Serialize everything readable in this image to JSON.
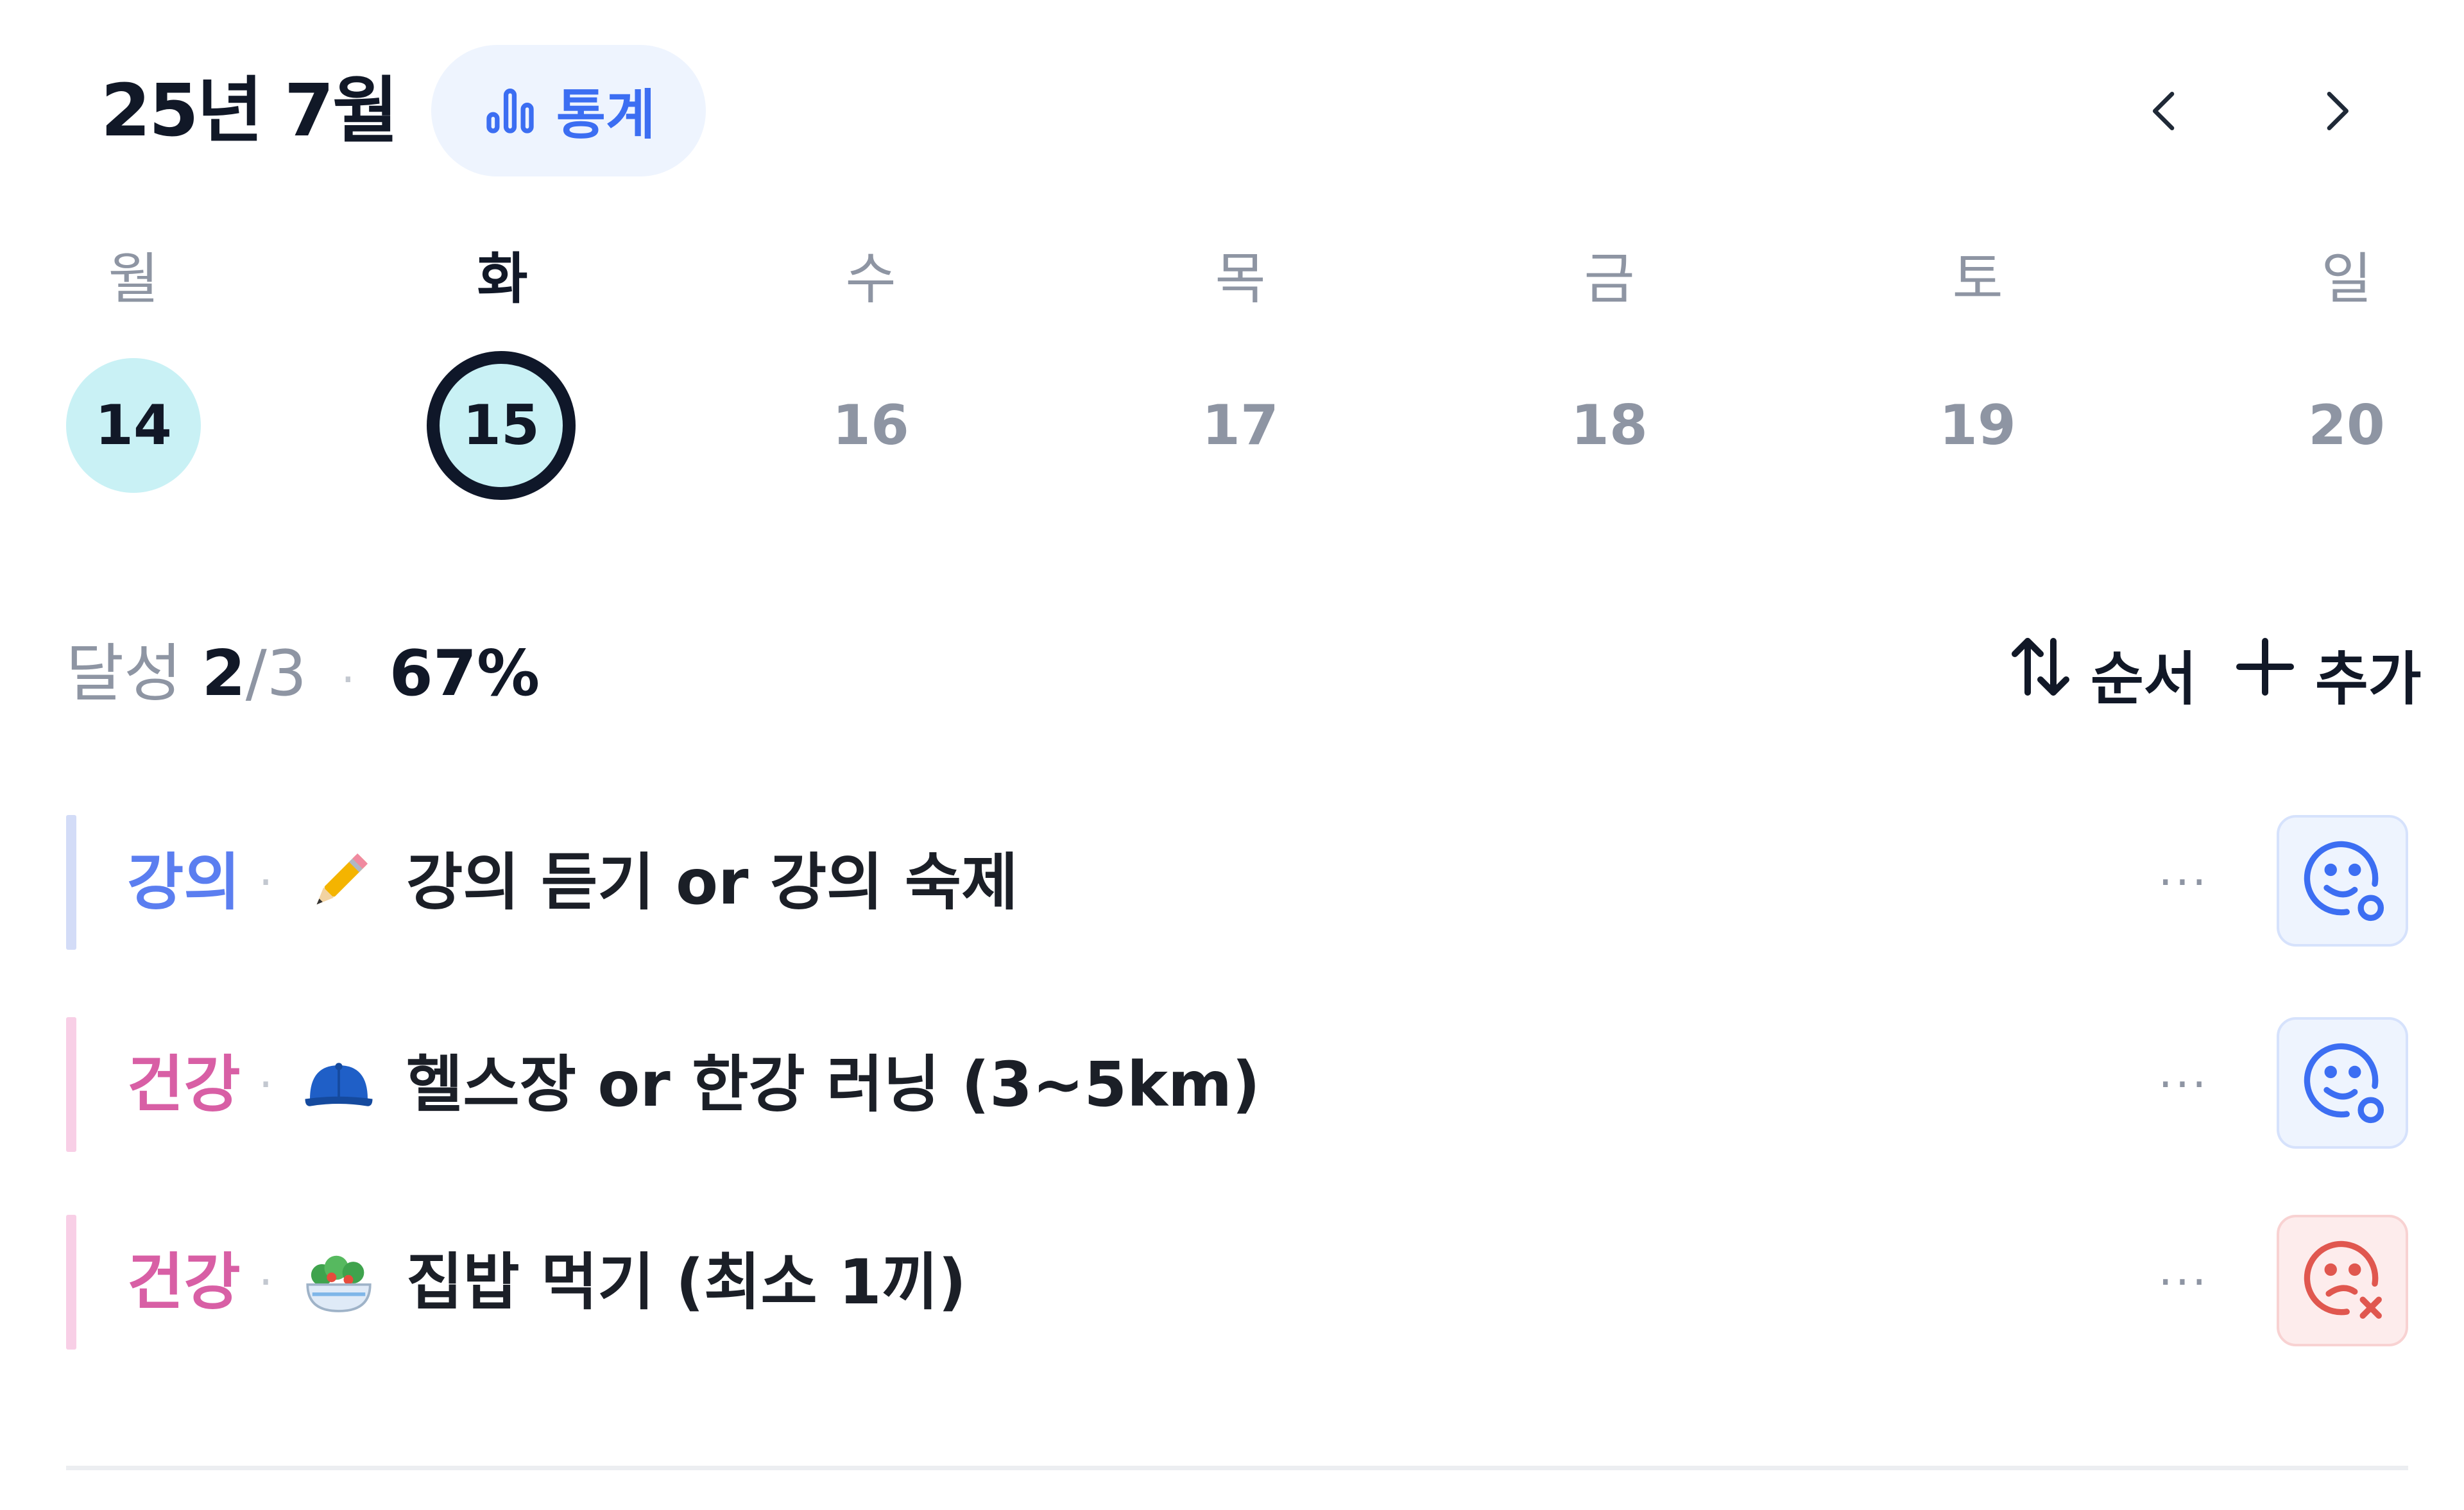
{
  "header": {
    "month_title": "25년 7월",
    "stats_label": "통계",
    "stats_icon": "bar-chart-icon",
    "prev_icon": "chevron-left-icon",
    "next_icon": "chevron-right-icon",
    "accent_color": "#3c6ef2"
  },
  "week": {
    "days": [
      {
        "name": "월",
        "date": "14",
        "state": "done"
      },
      {
        "name": "화",
        "date": "15",
        "state": "selected"
      },
      {
        "name": "수",
        "date": "16",
        "state": "future"
      },
      {
        "name": "목",
        "date": "17",
        "state": "future"
      },
      {
        "name": "금",
        "date": "18",
        "state": "future"
      },
      {
        "name": "토",
        "date": "19",
        "state": "future"
      },
      {
        "name": "일",
        "date": "20",
        "state": "future"
      }
    ],
    "done_color": "#c9f1f5"
  },
  "summary": {
    "label": "달성",
    "done": "2",
    "slash": "/",
    "total": "3",
    "separator": "·",
    "percent": "67%"
  },
  "toolbar": {
    "order_label": "순서",
    "order_icon": "sort-arrows-icon",
    "add_label": "추가",
    "add_icon": "plus-icon"
  },
  "habits": [
    {
      "category": "강의",
      "category_color": "#5b7ef0",
      "bar_color": "#d3dcf7",
      "separator": "·",
      "emoji_icon": "pencil-icon",
      "title": "강의 듣기 or 강의 숙제",
      "more": "···",
      "status": "done",
      "status_icon": "smile-check-icon"
    },
    {
      "category": "건강",
      "category_color": "#d85fa5",
      "bar_color": "#f8cfe6",
      "separator": "·",
      "emoji_icon": "cap-icon",
      "title": "헬스장 or 한강 러닝 (3~5km)",
      "more": "···",
      "status": "done",
      "status_icon": "smile-check-icon"
    },
    {
      "category": "건강",
      "category_color": "#d85fa5",
      "bar_color": "#f8cfe6",
      "separator": "·",
      "emoji_icon": "salad-bowl-icon",
      "title": "집밥 먹기 (최소 1끼)",
      "more": "···",
      "status": "failed",
      "status_icon": "sad-x-icon"
    }
  ]
}
